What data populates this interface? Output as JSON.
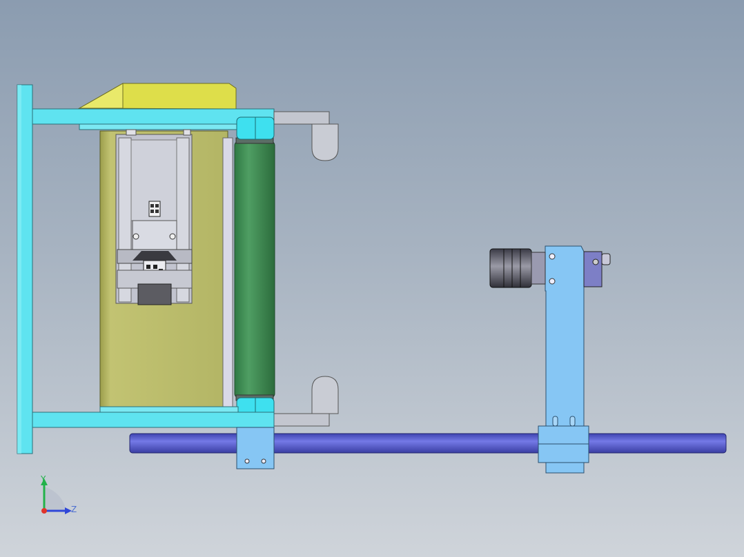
{
  "viewport": {
    "background_top": "#8b9cb0",
    "background_bottom": "#cfd4da"
  },
  "model": {
    "frame_color": "#5fe3f0",
    "housing_color": "#b7b966",
    "cover_color": "#dede4a",
    "roller_color": "#3f8f55",
    "shaft_color": "#5a5fcc",
    "bracket_color": "#86c6f4",
    "coupling_color": "#4a4a55"
  },
  "triad": {
    "y_label": "Y",
    "z_label": "Z",
    "y_color": "#22b24a",
    "z_color": "#2f47d8",
    "x_color": "#e0342b"
  }
}
